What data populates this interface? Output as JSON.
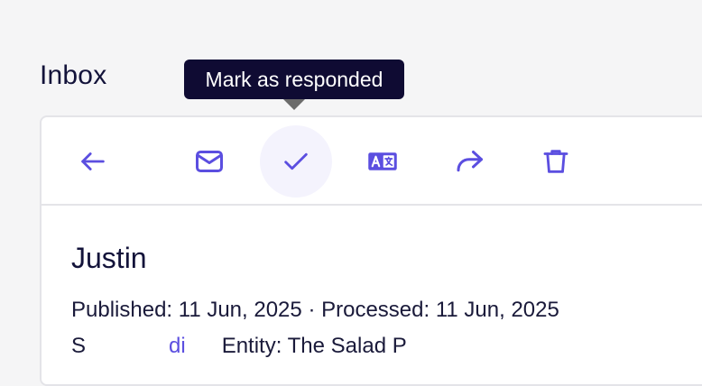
{
  "page": {
    "title": "Inbox"
  },
  "tooltip": {
    "text": "Mark as responded"
  },
  "toolbar": {
    "buttons": [
      {
        "icon": "arrow-left-icon",
        "action": "back"
      },
      {
        "icon": "envelope-icon",
        "action": "mark-unread"
      },
      {
        "icon": "check-icon",
        "action": "mark-as-responded",
        "active": true
      },
      {
        "icon": "translate-icon",
        "action": "translate"
      },
      {
        "icon": "forward-icon",
        "action": "forward"
      },
      {
        "icon": "trash-icon",
        "action": "delete"
      }
    ]
  },
  "message": {
    "sender": "Justin",
    "published_label": "Published:",
    "published_date": "11 Jun, 2025",
    "separator": "·",
    "processed_label": "Processed:",
    "processed_date": "11 Jun, 2025",
    "partial_line": {
      "prefix": "S",
      "link_text": "di",
      "middle": "Entity:",
      "suffix": "The Salad P"
    }
  },
  "colors": {
    "accent": "#5b4ee0",
    "tooltip_bg": "#0f0b33",
    "text_dark": "#13133a",
    "page_bg": "#f5f5f6",
    "card_border": "#e4e4e8",
    "active_button_bg": "#f4f3fd"
  }
}
